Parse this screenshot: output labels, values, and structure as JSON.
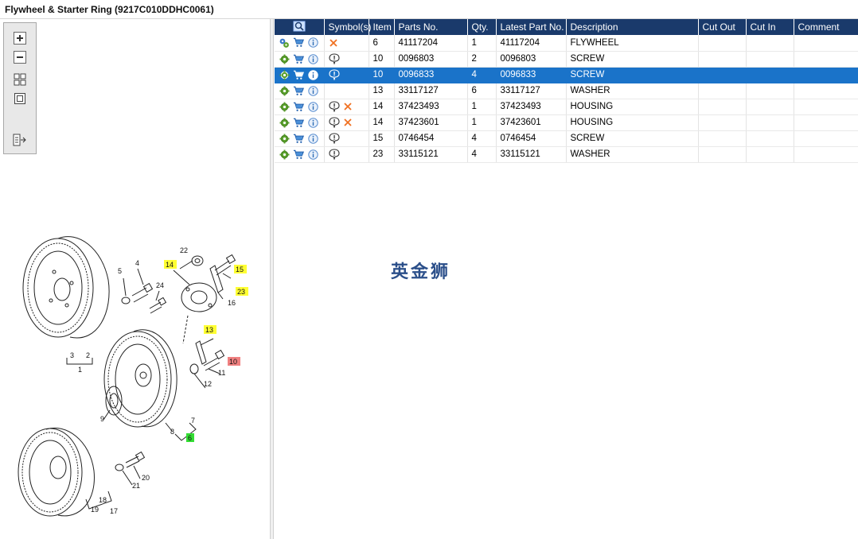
{
  "window": {
    "title": "Flywheel & Starter Ring (9217C010DDHC0061)"
  },
  "toolbox": {
    "buttons": [
      {
        "name": "zoom-in-icon"
      },
      {
        "name": "zoom-out-icon"
      },
      {
        "name": "fit-all-icon"
      },
      {
        "name": "fit-window-icon"
      },
      {
        "name": "export-icon"
      }
    ]
  },
  "watermark": {
    "text": "英金狮"
  },
  "table": {
    "columns": [
      "",
      "Symbol(s)",
      "Item",
      "Parts No.",
      "Qty.",
      "Latest Part No.",
      "Description",
      "Cut Out",
      "Cut In",
      "Comment"
    ],
    "rows": [
      {
        "symbols": [
          "cross"
        ],
        "item": "6",
        "parts_no": "41117204",
        "qty": "1",
        "latest": "41117204",
        "desc": "FLYWHEEL",
        "cut_out": "",
        "cut_in": "",
        "comment": "",
        "selected": false,
        "multi_gear": true
      },
      {
        "symbols": [
          "note"
        ],
        "item": "10",
        "parts_no": "0096803",
        "qty": "2",
        "latest": "0096803",
        "desc": "SCREW",
        "cut_out": "",
        "cut_in": "",
        "comment": "",
        "selected": false,
        "multi_gear": false
      },
      {
        "symbols": [
          "note"
        ],
        "item": "10",
        "parts_no": "0096833",
        "qty": "4",
        "latest": "0096833",
        "desc": "SCREW",
        "cut_out": "",
        "cut_in": "",
        "comment": "",
        "selected": true,
        "multi_gear": false
      },
      {
        "symbols": [],
        "item": "13",
        "parts_no": "33117127",
        "qty": "6",
        "latest": "33117127",
        "desc": "WASHER",
        "cut_out": "",
        "cut_in": "",
        "comment": "",
        "selected": false,
        "multi_gear": false
      },
      {
        "symbols": [
          "note",
          "cross"
        ],
        "item": "14",
        "parts_no": "37423493",
        "qty": "1",
        "latest": "37423493",
        "desc": "HOUSING",
        "cut_out": "",
        "cut_in": "",
        "comment": "",
        "selected": false,
        "multi_gear": false
      },
      {
        "symbols": [
          "note",
          "cross"
        ],
        "item": "14",
        "parts_no": "37423601",
        "qty": "1",
        "latest": "37423601",
        "desc": "HOUSING",
        "cut_out": "",
        "cut_in": "",
        "comment": "",
        "selected": false,
        "multi_gear": false
      },
      {
        "symbols": [
          "note"
        ],
        "item": "15",
        "parts_no": "0746454",
        "qty": "4",
        "latest": "0746454",
        "desc": "SCREW",
        "cut_out": "",
        "cut_in": "",
        "comment": "",
        "selected": false,
        "multi_gear": false
      },
      {
        "symbols": [
          "note"
        ],
        "item": "23",
        "parts_no": "33115121",
        "qty": "4",
        "latest": "33115121",
        "desc": "WASHER",
        "cut_out": "",
        "cut_in": "",
        "comment": "",
        "selected": false,
        "multi_gear": false
      }
    ]
  },
  "diagram": {
    "callouts": [
      {
        "label": "22",
        "highlight": ""
      },
      {
        "label": "14",
        "highlight": "yellow"
      },
      {
        "label": "15",
        "highlight": "yellow"
      },
      {
        "label": "5",
        "highlight": ""
      },
      {
        "label": "4",
        "highlight": ""
      },
      {
        "label": "24",
        "highlight": ""
      },
      {
        "label": "23",
        "highlight": "yellow"
      },
      {
        "label": "16",
        "highlight": ""
      },
      {
        "label": "13",
        "highlight": "yellow"
      },
      {
        "label": "10",
        "highlight": "red"
      },
      {
        "label": "11",
        "highlight": ""
      },
      {
        "label": "12",
        "highlight": ""
      },
      {
        "label": "3",
        "highlight": ""
      },
      {
        "label": "2",
        "highlight": ""
      },
      {
        "label": "1",
        "highlight": ""
      },
      {
        "label": "9",
        "highlight": ""
      },
      {
        "label": "8",
        "highlight": ""
      },
      {
        "label": "7",
        "highlight": ""
      },
      {
        "label": "6",
        "highlight": "green"
      },
      {
        "label": "20",
        "highlight": ""
      },
      {
        "label": "21",
        "highlight": ""
      },
      {
        "label": "18",
        "highlight": ""
      },
      {
        "label": "19",
        "highlight": ""
      },
      {
        "label": "17",
        "highlight": ""
      }
    ],
    "colors": {
      "yellow": "#ffff33",
      "red": "#f08080",
      "green": "#33dd33"
    }
  }
}
